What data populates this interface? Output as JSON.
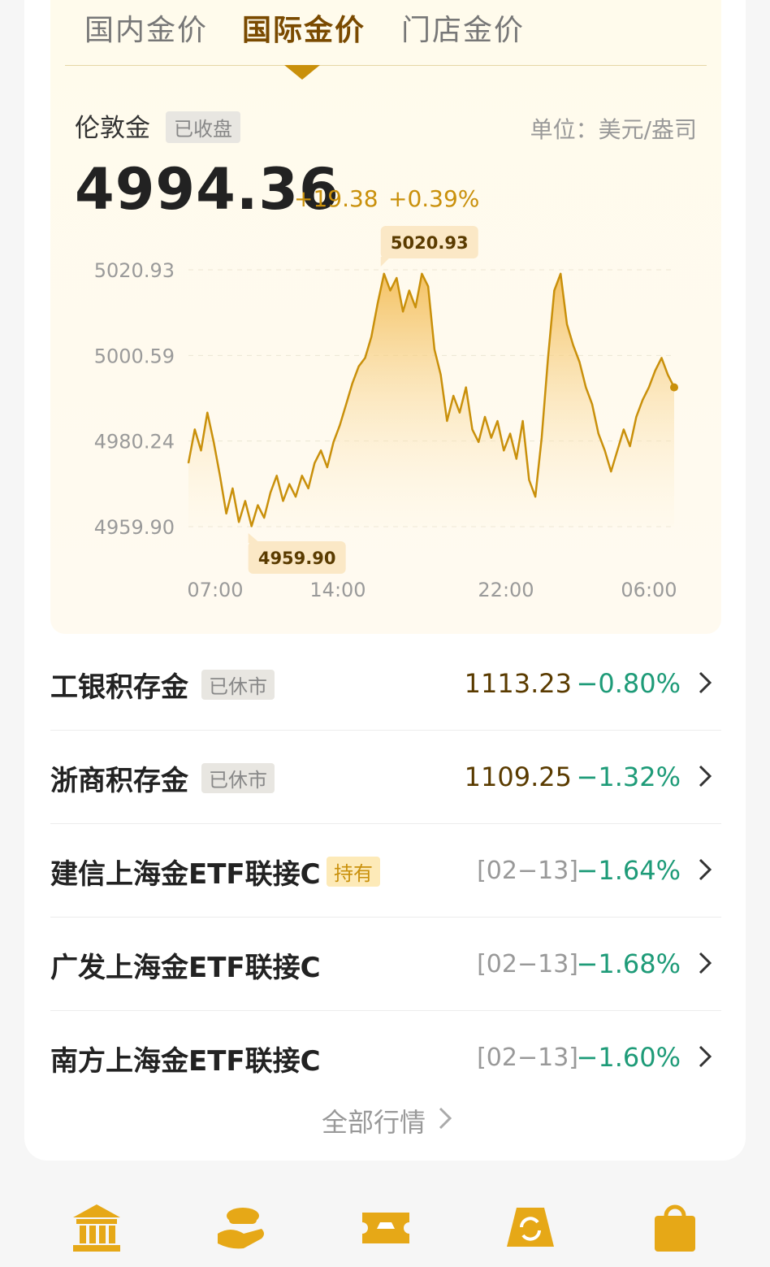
{
  "tabs": [
    {
      "label": "国内金价",
      "active": false
    },
    {
      "label": "国际金价",
      "active": true
    },
    {
      "label": "门店金价",
      "active": false
    }
  ],
  "instrument": {
    "name": "伦敦金",
    "status": "已收盘",
    "unit": "单位：美元/盎司",
    "price": "4994.36",
    "change": "+19.38",
    "change_pct": "+0.39%"
  },
  "chart_data": {
    "type": "area",
    "title": "",
    "xlabel": "",
    "ylabel": "",
    "ylim": [
      4959.9,
      5020.93
    ],
    "y_ticks": [
      "5020.93",
      "5000.59",
      "4980.24",
      "4959.90"
    ],
    "x_ticks": [
      "07:00",
      "14:00",
      "22:00",
      "06:00"
    ],
    "max_label": "5020.93",
    "min_label": "4959.90",
    "grid": true,
    "series": [
      {
        "values": [
          4975,
          4983,
          4978,
          4987,
          4980,
          4972,
          4963,
          4969,
          4961,
          4966,
          4960,
          4965,
          4962,
          4968,
          4972,
          4966,
          4970,
          4967,
          4972,
          4969,
          4975,
          4978,
          4974,
          4980,
          4984,
          4989,
          4994,
          4998,
          5000,
          5005,
          5013,
          5020,
          5016,
          5019,
          5011,
          5016,
          5012,
          5020,
          5017,
          5002,
          4996,
          4985,
          4991,
          4987,
          4993,
          4983,
          4980,
          4986,
          4981,
          4985,
          4978,
          4982,
          4976,
          4985,
          4971,
          4967,
          4981,
          5000,
          5016,
          5020,
          5008,
          5003,
          4999,
          4993,
          4989,
          4982,
          4978,
          4973,
          4978,
          4983,
          4979,
          4986,
          4990,
          4993,
          4997,
          5000,
          4996,
          4993
        ]
      }
    ]
  },
  "rows": [
    {
      "name": "工银积存金",
      "badge": "已休市",
      "badge_type": "closed",
      "value": "1113.23",
      "date": "",
      "pct": "−0.80%"
    },
    {
      "name": "浙商积存金",
      "badge": "已休市",
      "badge_type": "closed",
      "value": "1109.25",
      "date": "",
      "pct": "−1.32%"
    },
    {
      "name": "建信上海金ETF联接C",
      "badge": "持有",
      "badge_type": "hold",
      "value": "",
      "date": "[02−13]",
      "pct": "−1.64%"
    },
    {
      "name": "广发上海金ETF联接C",
      "badge": "",
      "badge_type": "",
      "value": "",
      "date": "[02−13]",
      "pct": "−1.68%"
    },
    {
      "name": "南方上海金ETF联接C",
      "badge": "",
      "badge_type": "",
      "value": "",
      "date": "[02−13]",
      "pct": "−1.60%"
    }
  ],
  "all_link": "全部行情",
  "colors": {
    "gold": "#c9900b",
    "down": "#1e9b78",
    "brown": "#5a3b00"
  },
  "bottom_nav": [
    {
      "icon": "bank-icon"
    },
    {
      "icon": "gold-ingot-hand-icon"
    },
    {
      "icon": "gold-ticket-icon"
    },
    {
      "icon": "recycle-gold-icon"
    },
    {
      "icon": "shopping-bag-icon"
    }
  ]
}
